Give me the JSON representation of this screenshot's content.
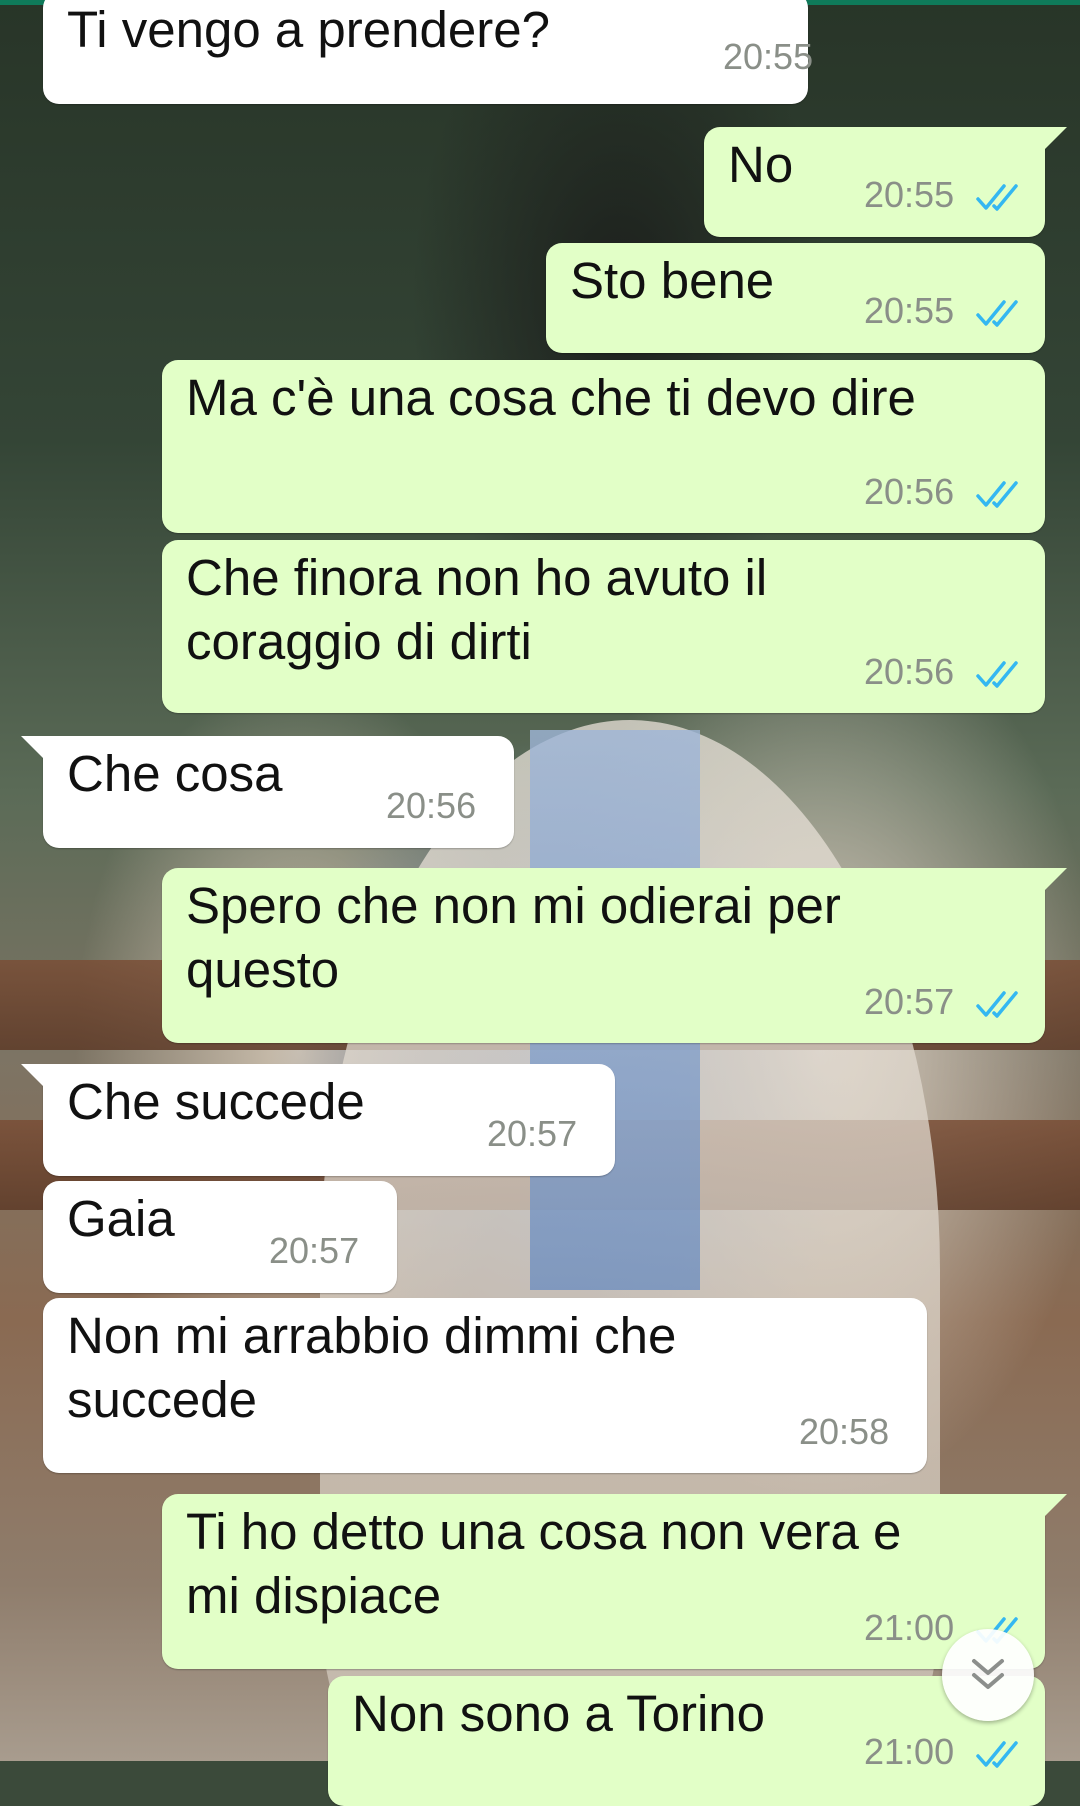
{
  "chat": {
    "messages": [
      {
        "direction": "in",
        "text": "Ti vengo a prendere?",
        "time": "20:55"
      },
      {
        "direction": "out",
        "text": "No",
        "time": "20:55",
        "status": "read"
      },
      {
        "direction": "out",
        "text": "Sto bene",
        "time": "20:55",
        "status": "read"
      },
      {
        "direction": "out",
        "text": "Ma c'è una cosa che ti devo dire",
        "time": "20:56",
        "status": "read"
      },
      {
        "direction": "out",
        "text": "Che finora non ho avuto il\ncoraggio di dirti",
        "time": "20:56",
        "status": "read"
      },
      {
        "direction": "in",
        "text": "Che cosa",
        "time": "20:56"
      },
      {
        "direction": "out",
        "text": "Spero che non mi odierai per\nquesto",
        "time": "20:57",
        "status": "read"
      },
      {
        "direction": "in",
        "text": "Che succede",
        "time": "20:57"
      },
      {
        "direction": "in",
        "text": "Gaia",
        "time": "20:57"
      },
      {
        "direction": "in",
        "text": "Non mi arrabbio dimmi che\nsuccede",
        "time": "20:58"
      },
      {
        "direction": "out",
        "text": "Ti ho detto una cosa non vera e\nmi dispiace",
        "time": "21:00",
        "status": "read"
      },
      {
        "direction": "out",
        "text": "Non sono a Torino",
        "time": "21:00",
        "status": "read"
      }
    ]
  },
  "colors": {
    "incoming_bubble": "#ffffff",
    "outgoing_bubble": "#e2ffc7",
    "read_ticks": "#34b7f1",
    "timestamp": "#8a8f88"
  },
  "icons": {
    "read_status": "double-check-icon",
    "scroll_down": "chevron-double-down-icon"
  }
}
